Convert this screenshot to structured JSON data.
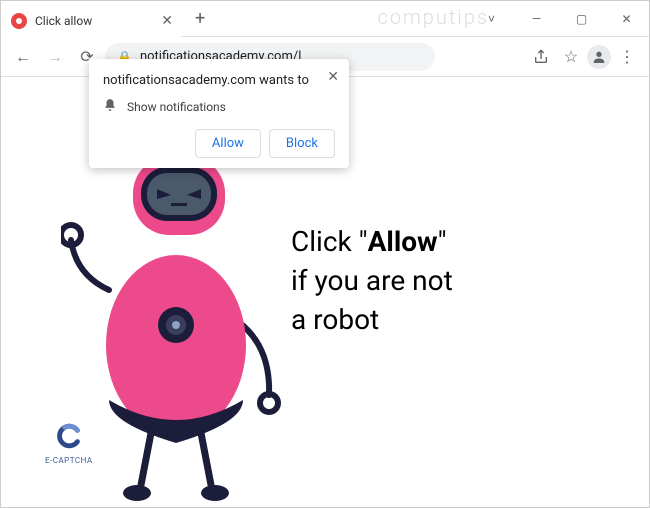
{
  "window": {
    "watermark": "computips"
  },
  "tab": {
    "title": "Click allow"
  },
  "address": {
    "url": "notificationsacademy.com/l"
  },
  "prompt": {
    "origin": "notificationsacademy.com wants to",
    "permission": "Show notifications",
    "allow": "Allow",
    "block": "Block"
  },
  "page": {
    "line1_pre": "Click \"",
    "line1_bold": "Allow",
    "line1_post": "\"",
    "line2": "if you are not",
    "line3": "a robot",
    "captcha_label": "E-CAPTCHA"
  }
}
